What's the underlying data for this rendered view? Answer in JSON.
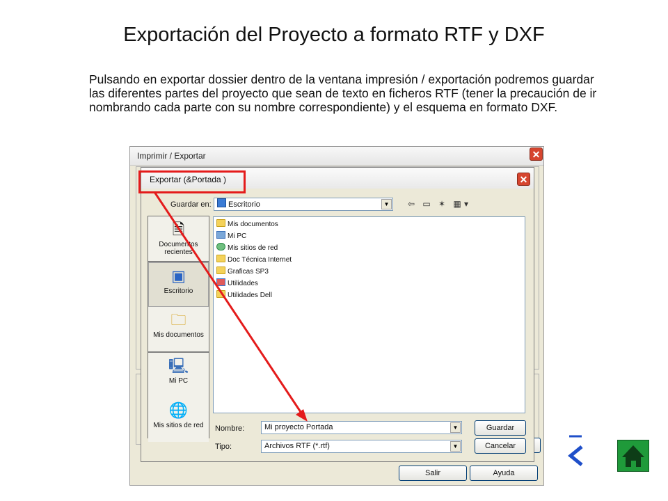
{
  "slide": {
    "title": "Exportación del Proyecto a formato RTF y DXF",
    "paragraph": "Pulsando en exportar dossier dentro de la ventana impresión / exportación podremos guardar las diferentes partes del proyecto que sean de texto en ficheros RTF (tener la precaución de ir nombrando cada parte con su nombre correspondiente) y el esquema en formato DXF."
  },
  "outer_dialog": {
    "title": "Imprimir / Exportar",
    "close": "✕",
    "salir_label": "Salir",
    "ayuda_label": "Ayuda"
  },
  "dialog": {
    "title": "Exportar (&Portada )",
    "close": "✕",
    "save_in_label": "Guardar en:",
    "save_in_value": "Escritorio",
    "places": [
      {
        "label": "Documentos recientes",
        "icon": "recent-documents-icon"
      },
      {
        "label": "Escritorio",
        "icon": "desktop-icon"
      },
      {
        "label": "Mis documentos",
        "icon": "my-documents-icon"
      },
      {
        "label": "Mi PC",
        "icon": "my-computer-icon"
      },
      {
        "label": "Mis sitios de red",
        "icon": "network-places-icon"
      }
    ],
    "files": [
      {
        "name": "Mis documentos",
        "icon": "my-documents-icon"
      },
      {
        "name": "Mi PC",
        "icon": "my-computer-icon"
      },
      {
        "name": "Mis sitios de red",
        "icon": "network-places-icon"
      },
      {
        "name": "Doc Técnica Internet",
        "icon": "folder-icon"
      },
      {
        "name": "Graficas SP3",
        "icon": "folder-icon"
      },
      {
        "name": "Utilidades",
        "icon": "utilities-icon"
      },
      {
        "name": "Utilidades Dell",
        "icon": "folder-icon"
      }
    ],
    "filename_label": "Nombre:",
    "filename_value": "Mi proyecto Portada",
    "filetype_label": "Tipo:",
    "filetype_value": "Archivos RTF (*.rtf)",
    "save_button": "Guardar",
    "cancel_button": "Cancelar"
  },
  "colors": {
    "highlight_red": "#e41b1b",
    "nav_green": "#1f9a3a"
  }
}
